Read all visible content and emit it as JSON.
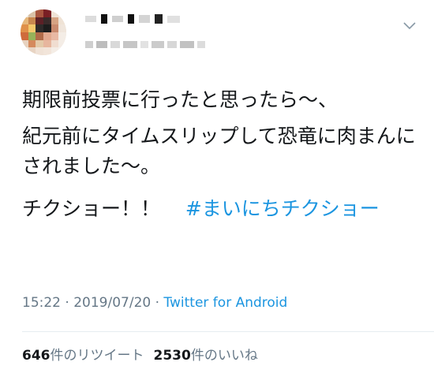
{
  "tweet": {
    "paragraphs": [
      "期限前投票に行ったと思ったら〜、",
      "紀元前にタイムスリップして恐竜に肉まんにされました〜。"
    ],
    "last_line_text": "チクショー！！",
    "hashtag": "#まいにちチクショー"
  },
  "meta": {
    "time": "15:22",
    "separator": " · ",
    "date": "2019/07/20",
    "source": "Twitter for Android"
  },
  "stats": {
    "retweet_count": "646",
    "retweet_label": "件のリツイート",
    "like_count": "2530",
    "like_label": "件のいいね"
  },
  "icons": {
    "menu": "chevron-down-icon"
  },
  "colors": {
    "link": "#1b95e0",
    "secondary": "#657786",
    "text": "#14171a"
  }
}
